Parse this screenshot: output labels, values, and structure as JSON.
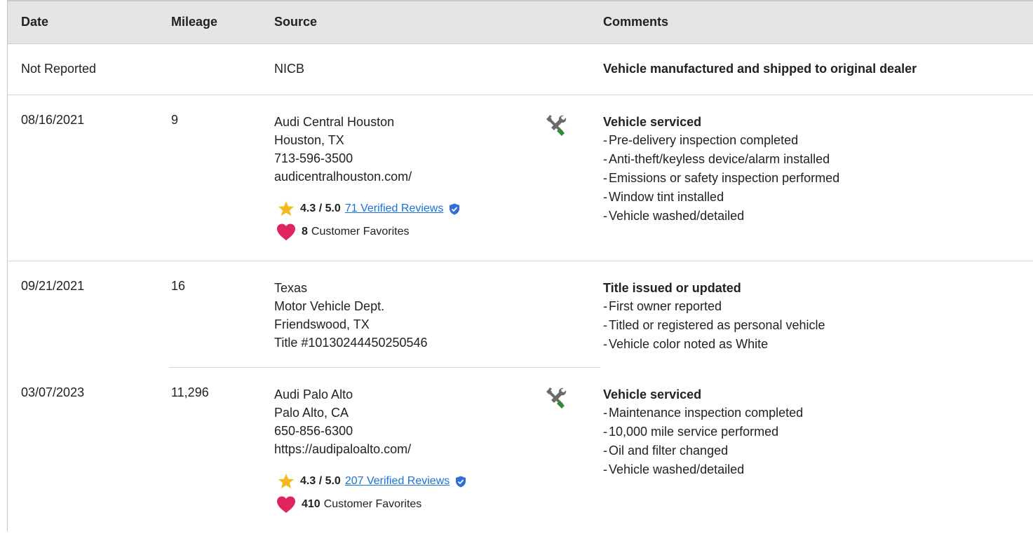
{
  "header": {
    "date": "Date",
    "mileage": "Mileage",
    "source": "Source",
    "comments": "Comments"
  },
  "rows": [
    {
      "date": "Not Reported",
      "mileage": "",
      "source": [
        "NICB"
      ],
      "comment_title": "Vehicle manufactured and shipped to original dealer",
      "comment_items": []
    },
    {
      "date": "08/16/2021",
      "mileage": "9",
      "source": [
        "Audi Central Houston",
        "Houston, TX",
        "713-596-3500",
        "audicentralhouston.com/"
      ],
      "rating": {
        "score": "4.3 / 5.0",
        "reviews": "71 Verified Reviews"
      },
      "favorites": {
        "count": "8",
        "label": "Customer Favorites"
      },
      "icon": "service-tools-icon",
      "comment_title": "Vehicle serviced",
      "comment_items": [
        "Pre-delivery inspection completed",
        "Anti-theft/keyless device/alarm installed",
        "Emissions or safety inspection performed",
        "Window tint installed",
        "Vehicle washed/detailed"
      ]
    },
    {
      "date": "09/21/2021",
      "mileage": "16",
      "source": [
        "Texas",
        "Motor Vehicle Dept.",
        "Friendswood, TX",
        "Title #10130244450250546"
      ],
      "comment_title": "Title issued or updated",
      "comment_items": [
        "First owner reported",
        "Titled or registered as personal vehicle",
        "Vehicle color noted as White"
      ]
    },
    {
      "date": "03/07/2023",
      "mileage": "11,296",
      "source": [
        "Audi Palo Alto",
        "Palo Alto, CA",
        "650-856-6300",
        "https://audipaloalto.com/"
      ],
      "rating": {
        "score": "4.3 / 5.0",
        "reviews": "207 Verified Reviews"
      },
      "favorites": {
        "count": "410",
        "label": "Customer Favorites"
      },
      "icon": "service-tools-icon",
      "comment_title": "Vehicle serviced",
      "comment_items": [
        "Maintenance inspection completed",
        "10,000 mile service performed",
        "Oil and filter changed",
        "Vehicle washed/detailed"
      ]
    }
  ],
  "colors": {
    "header_bg": "#e5e5e5",
    "link": "#1a73d8",
    "star": "#f5b820",
    "heart": "#e0245e",
    "verified": "#2f6fd6",
    "tool_green": "#2e8b3a",
    "tool_gray": "#6b6b6b"
  }
}
